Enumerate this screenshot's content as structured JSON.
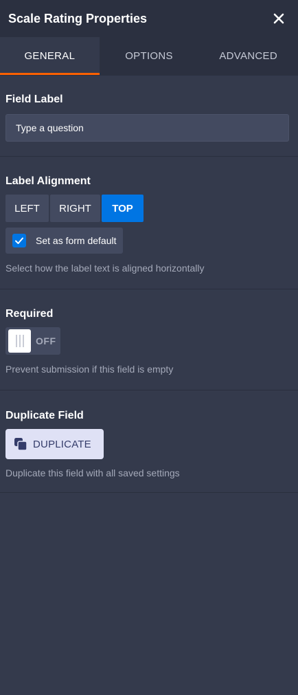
{
  "header": {
    "title": "Scale Rating Properties",
    "close_icon": "close-icon"
  },
  "tabs": [
    {
      "label": "GENERAL",
      "active": true
    },
    {
      "label": "OPTIONS",
      "active": false
    },
    {
      "label": "ADVANCED",
      "active": false
    }
  ],
  "field_label": {
    "title": "Field Label",
    "placeholder": "Type a question",
    "value": ""
  },
  "label_alignment": {
    "title": "Label Alignment",
    "options": [
      "LEFT",
      "RIGHT",
      "TOP"
    ],
    "selected": "TOP",
    "checkbox_label": "Set as form default",
    "checkbox_checked": true,
    "helper": "Select how the label text is aligned horizontally"
  },
  "required": {
    "title": "Required",
    "toggle_text": "OFF",
    "helper": "Prevent submission if this field is empty"
  },
  "duplicate": {
    "title": "Duplicate Field",
    "button_label": "DUPLICATE",
    "icon": "duplicate-icon",
    "helper": "Duplicate this field with all saved settings"
  },
  "colors": {
    "accent_tab": "#ff6100",
    "selected_blue": "#0075e3",
    "panel_bg": "#343a4c",
    "header_bg": "#2b3040"
  }
}
